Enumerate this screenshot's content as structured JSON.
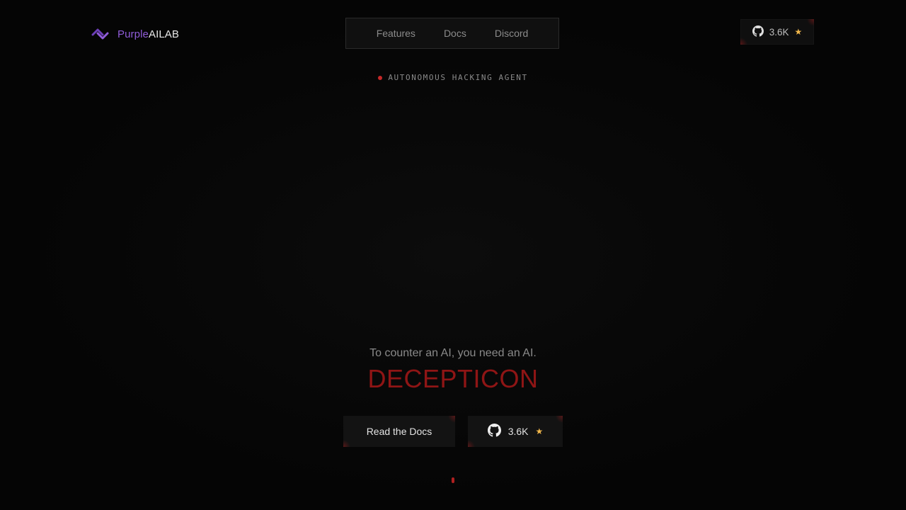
{
  "brand": {
    "name_part1": "Purple",
    "name_part2": "AILAB",
    "logo_icon": "link-chain-icon",
    "accent_color": "#8f5cd8"
  },
  "nav": {
    "items": [
      {
        "label": "Features"
      },
      {
        "label": "Docs"
      },
      {
        "label": "Discord"
      }
    ]
  },
  "github": {
    "stars": "3.6K",
    "icon": "github-icon",
    "star_icon": "star-icon",
    "star_color": "#f2b84b"
  },
  "badge": {
    "text": "AUTONOMOUS HACKING AGENT",
    "dot_color": "#c62828"
  },
  "hero": {
    "tagline": "To counter an AI, you need an AI.",
    "title": "DECEPTICON",
    "title_color": "#8f1515"
  },
  "cta": {
    "docs_label": "Read the Docs",
    "github_stars": "3.6K"
  }
}
